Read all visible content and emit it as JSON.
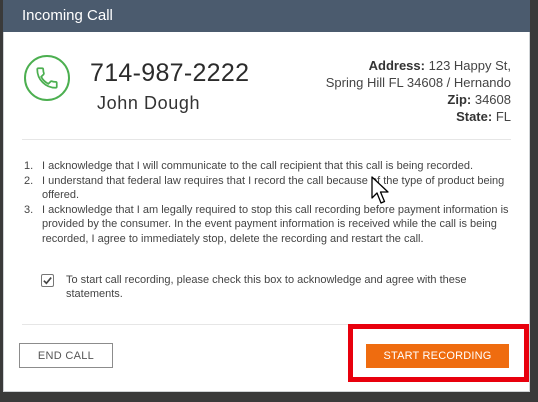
{
  "window": {
    "title": "Incoming Call"
  },
  "caller": {
    "phone": "714-987-2222",
    "name": "John Dough",
    "address_label": "Address:",
    "address_line1": "123 Happy St,",
    "address_line2": "Spring Hill FL 34608 / Hernando",
    "zip_label": "Zip:",
    "zip": "34608",
    "state_label": "State:",
    "state": "FL"
  },
  "statements": [
    {
      "num": "1.",
      "text": "I acknowledge that I will communicate to the call recipient that this call is being recorded."
    },
    {
      "num": "2.",
      "text": "I understand that federal law requires that I record the call because of the type of product being offered."
    },
    {
      "num": "3.",
      "text": "I acknowledge that I am legally required to stop this call recording before payment information is provided by the consumer. In the event payment information is received while the call is being recorded, I agree to immediately stop, delete the recording and restart the call."
    }
  ],
  "acknowledge": {
    "checked": true,
    "text": "To start call recording, please check this box to acknowledge and agree with these statements."
  },
  "buttons": {
    "end_call": "END CALL",
    "start_recording": "START RECORDING"
  },
  "colors": {
    "titlebar": "#4b5b6e",
    "phone_icon": "#4caf50",
    "primary_button": "#ef6c0f",
    "highlight": "#e8000d"
  }
}
